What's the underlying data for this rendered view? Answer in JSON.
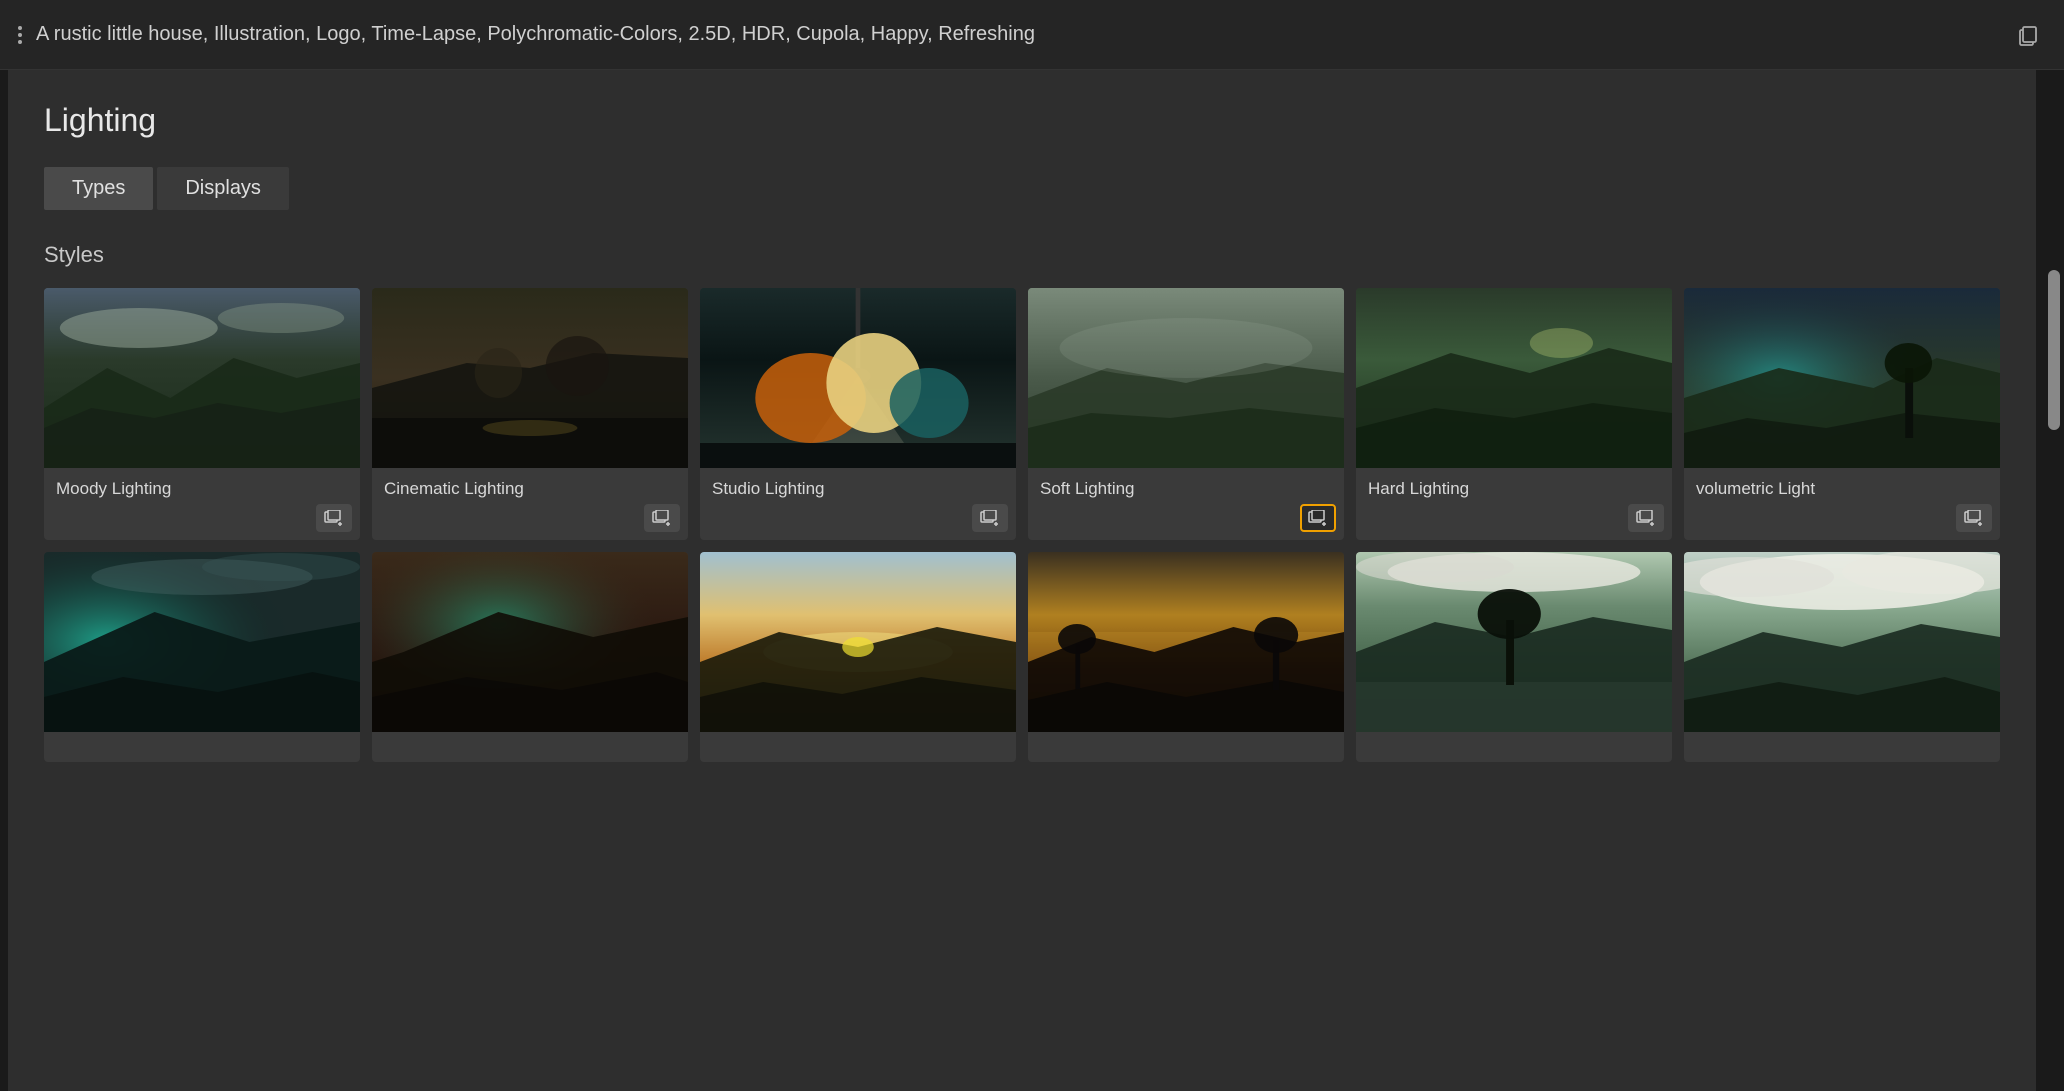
{
  "topbar": {
    "prompt_text": "A rustic little house, Illustration, Logo, Time-Lapse, Polychromatic-Colors, 2.5D, HDR, Cupola, Happy, Refreshing",
    "dots_label": "more-options",
    "copy_label": "copy"
  },
  "page": {
    "title": "Lighting",
    "tabs": [
      {
        "id": "types",
        "label": "Types",
        "active": true
      },
      {
        "id": "displays",
        "label": "Displays",
        "active": false
      }
    ],
    "section_title": "Styles"
  },
  "styles": {
    "row1": [
      {
        "id": "moody",
        "name": "Moody Lighting",
        "highlighted": false,
        "img_class": "img-moody"
      },
      {
        "id": "cinematic",
        "name": "Cinematic Lighting",
        "highlighted": false,
        "img_class": "img-cinematic"
      },
      {
        "id": "studio",
        "name": "Studio Lighting",
        "highlighted": false,
        "img_class": "img-studio"
      },
      {
        "id": "soft",
        "name": "Soft Lighting",
        "highlighted": true,
        "img_class": "img-soft"
      },
      {
        "id": "hard",
        "name": "Hard Lighting",
        "highlighted": false,
        "img_class": "img-hard"
      },
      {
        "id": "volumetric",
        "name": "volumetric Light",
        "highlighted": false,
        "img_class": "img-volumetric"
      }
    ],
    "row2": [
      {
        "id": "r2-1",
        "name": "",
        "img_class": "img-r2-1"
      },
      {
        "id": "r2-2",
        "name": "",
        "img_class": "img-r2-2"
      },
      {
        "id": "r2-3",
        "name": "",
        "img_class": "img-r2-3"
      },
      {
        "id": "r2-4",
        "name": "",
        "img_class": "img-r2-4"
      },
      {
        "id": "r2-5",
        "name": "",
        "img_class": "img-r2-5"
      },
      {
        "id": "r2-6",
        "name": "",
        "img_class": "img-r2-6"
      }
    ]
  }
}
